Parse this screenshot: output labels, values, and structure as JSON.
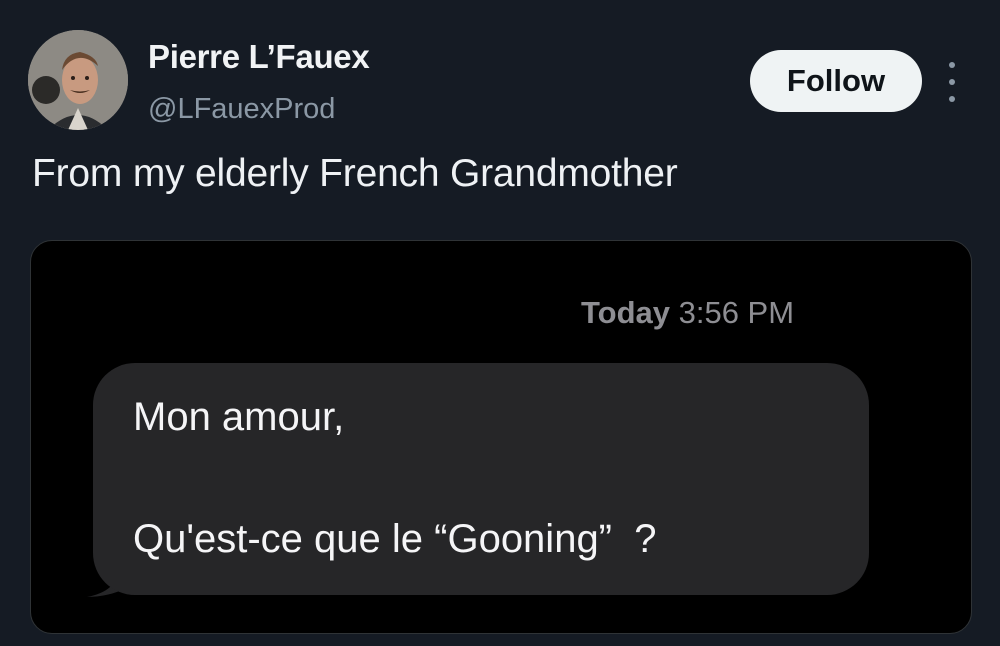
{
  "author": {
    "display_name": "Pierre L’Fauex",
    "handle": "@LFauexProd",
    "avatar_icon": "profile-photo-icon"
  },
  "actions": {
    "follow_label": "Follow",
    "more_icon": "more-vertical-icon"
  },
  "tweet": {
    "text": "From my elderly French Grandmother"
  },
  "screenshot": {
    "timestamp_day": "Today",
    "timestamp_time": " 3:56 PM",
    "message_line1": "Mon amour,",
    "message_line2": "Qu'est-ce que le “Gooning”  ?"
  },
  "colors": {
    "background": "#151b24",
    "follow_button_bg": "#eff3f4",
    "bubble_bg": "#262628",
    "secondary_text": "#8b98a5"
  }
}
